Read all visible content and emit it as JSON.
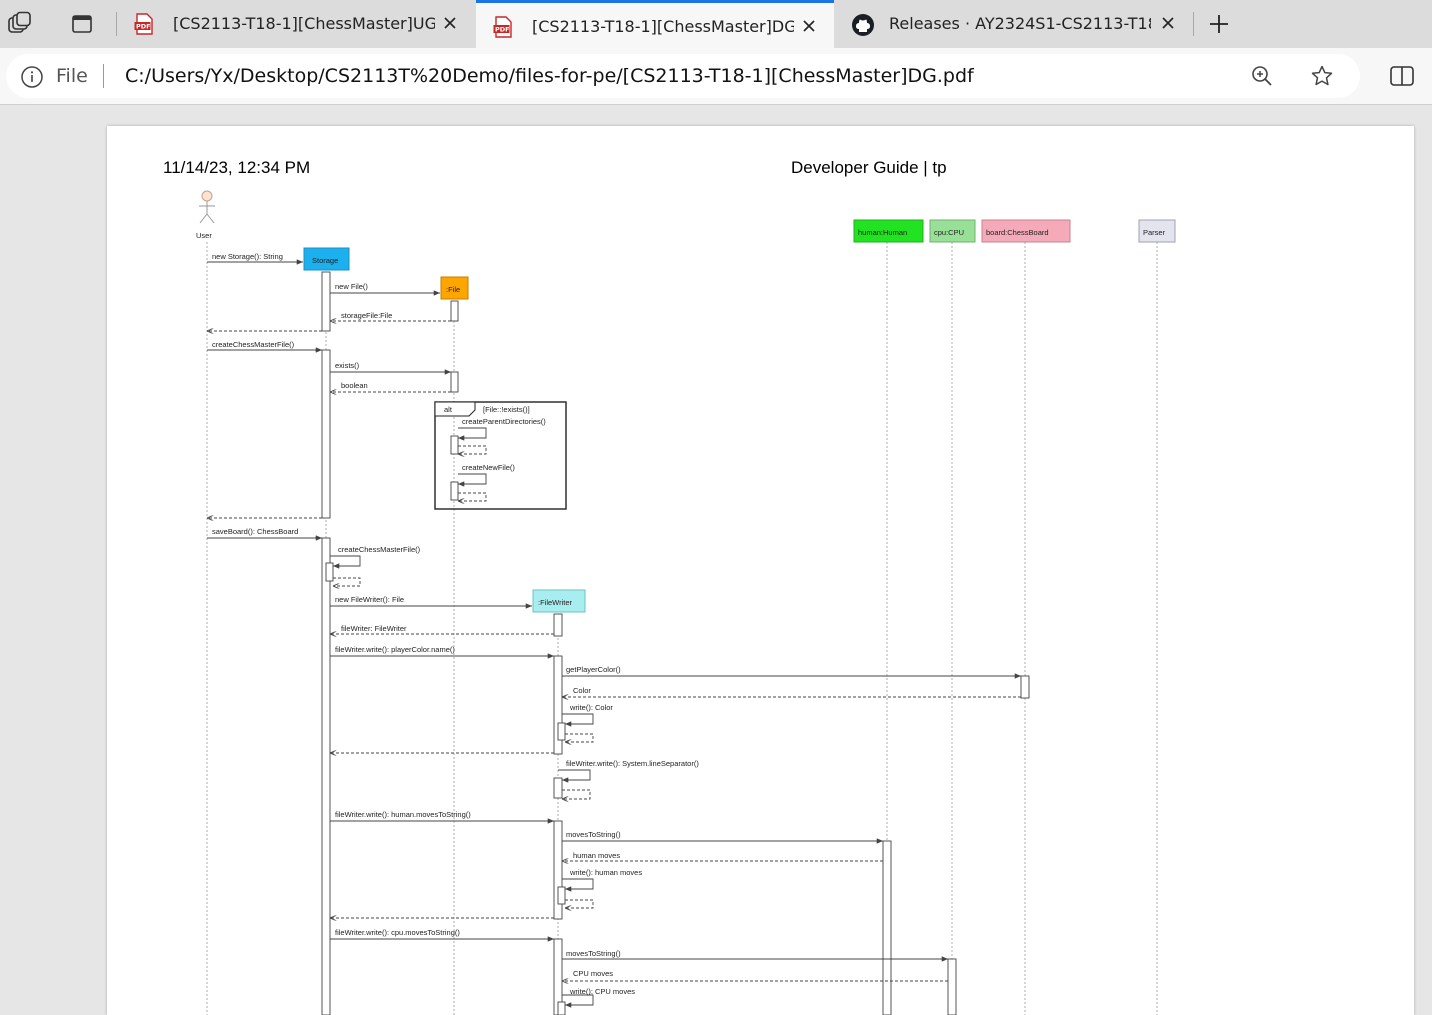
{
  "tabs": [
    {
      "label": "[CS2113-T18-1][ChessMaster]UG.pdf",
      "icon": "pdf-icon",
      "active": false
    },
    {
      "label": "[CS2113-T18-1][ChessMaster]DG.pdf",
      "icon": "pdf-icon",
      "active": true
    },
    {
      "label": "Releases · AY2324S1-CS2113-T18-1/tp",
      "icon": "github-icon",
      "active": false
    }
  ],
  "address": {
    "scheme": "File",
    "url": "C:/Users/Yx/Desktop/CS2113T%20Demo/files-for-pe/[CS2113-T18-1][ChessMaster]DG.pdf"
  },
  "page_header": {
    "datetime": "11/14/23, 12:34 PM",
    "title": "Developer Guide | tp"
  },
  "diagram": {
    "actor": "User",
    "participants": {
      "storage": "Storage",
      "file": ":File",
      "filewriter": ":FileWriter",
      "human": "human:Human",
      "cpu": "cpu:CPU",
      "board": "board:ChessBoard",
      "parser": "Parser"
    },
    "messages": {
      "m1": "new Storage(): String",
      "m2": "new File()",
      "m3": "storageFile:File",
      "m4": "createChessMasterFile()",
      "m5": "exists()",
      "m6": "boolean",
      "alt_label": "alt",
      "alt_cond": "[File::!exists()]",
      "m7": "createParentDirectories()",
      "m8": "createNewFile()",
      "m9": "saveBoard(): ChessBoard",
      "m10": "createChessMasterFile()",
      "m11": "new FileWriter(): File",
      "m12": "fileWriter: FileWriter",
      "m13": "fileWriter.write(): playerColor.name()",
      "m14": "getPlayerColor()",
      "m15": "Color",
      "m16": "write(): Color",
      "m17": "fileWriter.write(): System.lineSeparator()",
      "m18": "fileWriter.write(): human.movesToString()",
      "m19": "movesToString()",
      "m20": "human moves",
      "m21": "write(): human moves",
      "m22": "fileWriter.write(): cpu.movesToString()",
      "m23": "movesToString()",
      "m24": "CPU moves",
      "m25": "write(): CPU moves"
    },
    "colors": {
      "storage": "#1cb0ee",
      "file": "#ffa500",
      "filewriter": "#a8eef0",
      "human": "#22e322",
      "cpu": "#98e098",
      "board": "#f4aab8",
      "parser": "#e4e4ee"
    }
  }
}
